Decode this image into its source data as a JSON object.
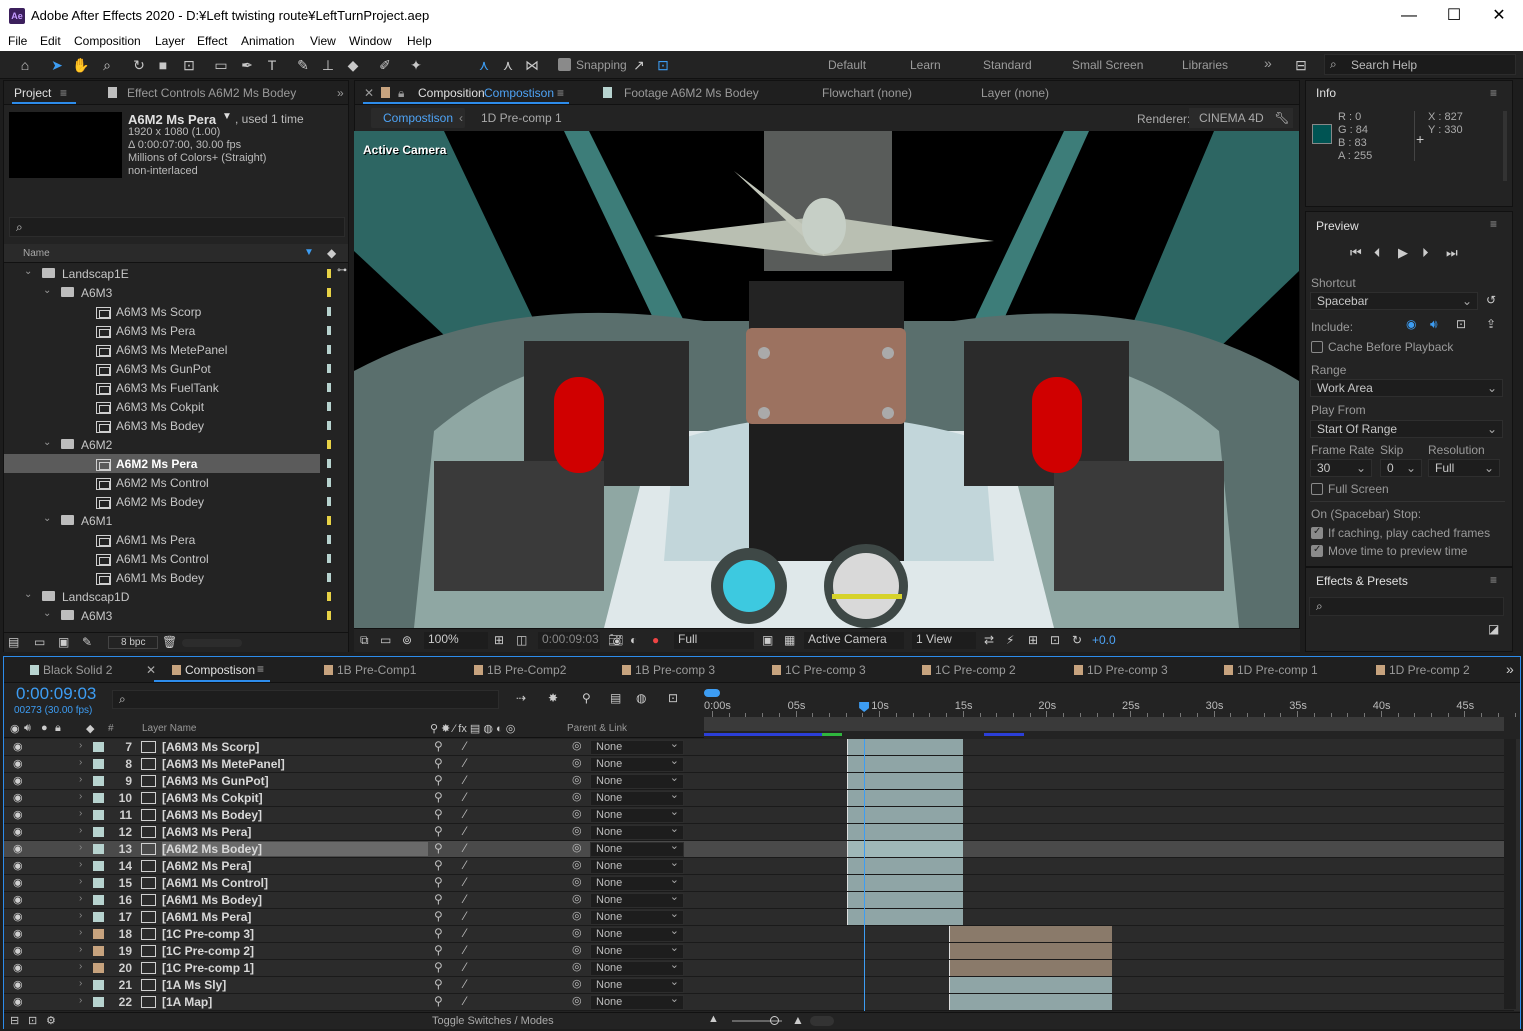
{
  "title": "Adobe After Effects 2020 - D:¥Left twisting route¥LeftTurnProject.aep",
  "menu": [
    "File",
    "Edit",
    "Composition",
    "Layer",
    "Effect",
    "Animation",
    "View",
    "Window",
    "Help"
  ],
  "toolbar": {
    "snapping": "Snapping",
    "workspaces": [
      "Default",
      "Learn",
      "Standard",
      "Small Screen",
      "Libraries"
    ],
    "search_placeholder": "Search Help"
  },
  "project": {
    "tab": "Project",
    "effect_tab": "Effect Controls A6M2 Ms Bodey",
    "selected_name": "A6M2 Ms Pera",
    "used": ", used 1 time",
    "details": [
      "1920 x 1080 (1.00)",
      "Δ 0:00:07:00, 30.00 fps",
      "Millions of Colors+ (Straight)",
      "non-interlaced"
    ],
    "col_name": "Name",
    "tree": [
      {
        "label": "Landscap1E",
        "type": "folder",
        "indent": 0,
        "open": true,
        "color": "yellow"
      },
      {
        "label": "A6M3",
        "type": "folder",
        "indent": 1,
        "open": true,
        "color": "yellow"
      },
      {
        "label": "A6M3 Ms Scorp",
        "type": "comp",
        "indent": 2,
        "color": "cyan"
      },
      {
        "label": "A6M3 Ms Pera",
        "type": "comp",
        "indent": 2,
        "color": "cyan"
      },
      {
        "label": "A6M3 Ms MetePanel",
        "type": "comp",
        "indent": 2,
        "color": "cyan"
      },
      {
        "label": "A6M3 Ms GunPot",
        "type": "comp",
        "indent": 2,
        "color": "cyan"
      },
      {
        "label": "A6M3 Ms FuelTank",
        "type": "comp",
        "indent": 2,
        "color": "cyan"
      },
      {
        "label": "A6M3 Ms Cokpit",
        "type": "comp",
        "indent": 2,
        "color": "cyan"
      },
      {
        "label": "A6M3 Ms Bodey",
        "type": "comp",
        "indent": 2,
        "color": "cyan"
      },
      {
        "label": "A6M2",
        "type": "folder",
        "indent": 1,
        "open": true,
        "color": "yellow"
      },
      {
        "label": "A6M2 Ms Pera",
        "type": "comp",
        "indent": 2,
        "color": "cyan",
        "selected": true
      },
      {
        "label": "A6M2 Ms Control",
        "type": "comp",
        "indent": 2,
        "color": "cyan"
      },
      {
        "label": "A6M2 Ms Bodey",
        "type": "comp",
        "indent": 2,
        "color": "cyan"
      },
      {
        "label": "A6M1",
        "type": "folder",
        "indent": 1,
        "open": true,
        "color": "yellow"
      },
      {
        "label": "A6M1 Ms Pera",
        "type": "comp",
        "indent": 2,
        "color": "cyan"
      },
      {
        "label": "A6M1 Ms Control",
        "type": "comp",
        "indent": 2,
        "color": "cyan"
      },
      {
        "label": "A6M1 Ms Bodey",
        "type": "comp",
        "indent": 2,
        "color": "cyan"
      },
      {
        "label": "Landscap1D",
        "type": "folder",
        "indent": 0,
        "open": true,
        "color": "yellow"
      },
      {
        "label": "A6M3",
        "type": "folder",
        "indent": 1,
        "open": true,
        "color": "yellow"
      }
    ],
    "bpc": "8 bpc"
  },
  "comp_viewer": {
    "tabs": [
      "Composition",
      "Compostison",
      "Footage A6M2 Ms Bodey",
      "Flowchart (none)",
      "Layer (none)"
    ],
    "breadcrumbs": [
      "Compostison",
      "1D Pre-comp 1"
    ],
    "renderer_label": "Renderer:",
    "renderer": "CINEMA 4D",
    "overlay": "Active Camera",
    "zoom": "100%",
    "time": "0:00:09:03",
    "quality": "Full",
    "camera": "Active Camera",
    "views": "1 View",
    "exposure": "+0.0"
  },
  "info": {
    "tab": "Info",
    "r": "R : 0",
    "g": "G : 84",
    "b": "B : 83",
    "a": "A : 255",
    "x": "X : 827",
    "y": "Y : 330",
    "swatch": "#005453"
  },
  "preview": {
    "tab": "Preview",
    "shortcut_label": "Shortcut",
    "shortcut": "Spacebar",
    "include_label": "Include:",
    "cache": "Cache Before Playback",
    "range_label": "Range",
    "range": "Work Area",
    "playfrom_label": "Play From",
    "playfrom": "Start Of Range",
    "framerate_label": "Frame Rate",
    "skip_label": "Skip",
    "resolution_label": "Resolution",
    "framerate": "30",
    "skip": "0",
    "resolution": "Full",
    "fullscreen": "Full Screen",
    "stop_label": "On (Spacebar) Stop:",
    "opt1": "If caching, play cached frames",
    "opt2": "Move time to preview time"
  },
  "effects": {
    "tab": "Effects & Presets"
  },
  "timeline": {
    "tabs": [
      "Black Solid 2",
      "Compostison",
      "1B Pre-Comp1",
      "1B Pre-Comp2",
      "1B Pre-comp 3",
      "1C Pre-comp 3",
      "1C Pre-comp 2",
      "1D Pre-comp 3",
      "1D Pre-comp 1",
      "1D Pre-comp 2"
    ],
    "timecode": "0:00:09:03",
    "frames": "00273 (30.00 fps)",
    "col_layer": "Layer Name",
    "col_parent": "Parent & Link",
    "ruler": [
      "0:00s",
      "05s",
      "10s",
      "15s",
      "20s",
      "25s",
      "30s",
      "35s",
      "40s",
      "45s"
    ],
    "toggle": "Toggle Switches / Modes",
    "layers": [
      {
        "num": "7",
        "name": "[A6M3 Ms Scorp]",
        "parent": "None",
        "color": "#b7d3cf",
        "start": 0,
        "end": 7,
        "bar": "#8fa5a6"
      },
      {
        "num": "8",
        "name": "[A6M3 Ms MetePanel]",
        "parent": "None",
        "color": "#b7d3cf",
        "start": 0,
        "end": 7,
        "bar": "#8fa5a6"
      },
      {
        "num": "9",
        "name": "[A6M3 Ms GunPot]",
        "parent": "None",
        "color": "#b7d3cf",
        "start": 0,
        "end": 7,
        "bar": "#8fa5a6"
      },
      {
        "num": "10",
        "name": "[A6M3 Ms Cokpit]",
        "parent": "None",
        "color": "#b7d3cf",
        "start": 0,
        "end": 7,
        "bar": "#8fa5a6"
      },
      {
        "num": "11",
        "name": "[A6M3 Ms Bodey]",
        "parent": "None",
        "color": "#b7d3cf",
        "start": 0,
        "end": 7,
        "bar": "#8fa5a6"
      },
      {
        "num": "12",
        "name": "[A6M3 Ms Pera]",
        "parent": "None",
        "color": "#b7d3cf",
        "start": 0,
        "end": 7,
        "bar": "#8fa5a6"
      },
      {
        "num": "13",
        "name": "[A6M2 Ms Bodey]",
        "parent": "None",
        "color": "#b7d3cf",
        "start": 0,
        "end": 7,
        "bar": "#9fb8b8",
        "selected": true
      },
      {
        "num": "14",
        "name": "[A6M2 Ms Pera]",
        "parent": "None",
        "color": "#b7d3cf",
        "start": 0,
        "end": 7,
        "bar": "#8fa5a6"
      },
      {
        "num": "15",
        "name": "[A6M1 Ms Control]",
        "parent": "None",
        "color": "#b7d3cf",
        "start": 0,
        "end": 7,
        "bar": "#8fa5a6"
      },
      {
        "num": "16",
        "name": "[A6M1 Ms Bodey]",
        "parent": "None",
        "color": "#b7d3cf",
        "start": 0,
        "end": 7,
        "bar": "#8fa5a6"
      },
      {
        "num": "17",
        "name": "[A6M1 Ms Pera]",
        "parent": "None",
        "color": "#b7d3cf",
        "start": 0,
        "end": 7,
        "bar": "#8fa5a6"
      },
      {
        "num": "18",
        "name": "[1C Pre-comp 3]",
        "parent": "None",
        "color": "#c7a37e",
        "start": 5.7,
        "end": 15.4,
        "bar": "#8a7a6a"
      },
      {
        "num": "19",
        "name": "[1C Pre-comp 2]",
        "parent": "None",
        "color": "#c7a37e",
        "start": 5.7,
        "end": 15.4,
        "bar": "#8a7a6a"
      },
      {
        "num": "20",
        "name": "[1C Pre-comp 1]",
        "parent": "None",
        "color": "#c7a37e",
        "start": 5.7,
        "end": 15.4,
        "bar": "#8a7a6a"
      },
      {
        "num": "21",
        "name": "[1A Ms Sly]",
        "parent": "None",
        "color": "#b7d3cf",
        "start": 5.7,
        "end": 15.4,
        "bar": "#8fa5a6"
      },
      {
        "num": "22",
        "name": "[1A Map]",
        "parent": "None",
        "color": "#b7d3cf",
        "start": 5.7,
        "end": 15.4,
        "bar": "#8fa5a6"
      }
    ]
  }
}
